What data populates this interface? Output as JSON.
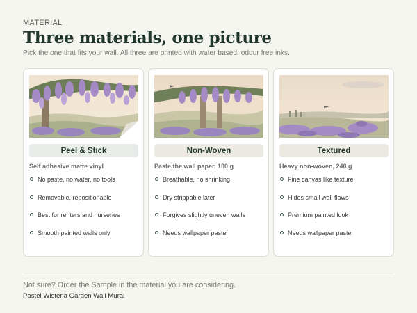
{
  "header": {
    "eyebrow": "MATERIAL",
    "title": "Three materials, one picture",
    "subtitle": "Pick the one that fits your wall. All three are printed with water based, odour free inks."
  },
  "colors": {
    "background": "#f6f6f1",
    "title": "#21362c",
    "pill_selected": "#e7ece8",
    "pill_default": "#ece9e3",
    "bullet": "#3b5a49"
  },
  "materials": [
    {
      "name": "Peel & Stick",
      "description": "Self adhesive matte vinyl",
      "selected": true,
      "image": "wisteria-arch-preview-corner-peel",
      "features": [
        "No paste, no water, no tools",
        "Removable, repositionable",
        "Best for renters and nurseries",
        "Smooth painted walls only"
      ]
    },
    {
      "name": "Non-Woven",
      "description": "Paste the wall paper, 180 g",
      "selected": false,
      "image": "wisteria-pergola-preview",
      "features": [
        "Breathable, no shrinking",
        "Dry strippable later",
        "Forgives slightly uneven walls",
        "Needs wallpaper paste"
      ]
    },
    {
      "name": "Textured",
      "description": "Heavy non-woven, 240 g",
      "selected": false,
      "image": "wisteria-meadow-preview",
      "features": [
        "Fine canvas like texture",
        "Hides small wall flaws",
        "Premium painted look",
        "Needs wallpaper paste"
      ]
    }
  ],
  "footer": {
    "note": "Not sure? Order the Sample in the material you are considering.",
    "product": "Pastel Wisteria Garden Wall Mural"
  }
}
